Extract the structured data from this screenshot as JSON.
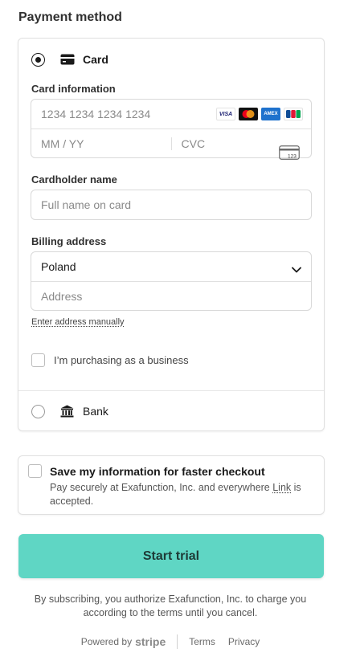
{
  "title": "Payment method",
  "card_option": {
    "label": "Card",
    "selected": true
  },
  "card_info": {
    "label": "Card information",
    "number_placeholder": "1234 1234 1234 1234",
    "expiry_placeholder": "MM / YY",
    "cvc_placeholder": "CVC",
    "brands": [
      "visa-icon",
      "mastercard-icon",
      "amex-icon",
      "jcb-icon"
    ]
  },
  "cardholder": {
    "label": "Cardholder name",
    "placeholder": "Full name on card"
  },
  "billing": {
    "label": "Billing address",
    "country": "Poland",
    "address_placeholder": "Address",
    "manual_link": "Enter address manually"
  },
  "business_checkbox": {
    "label": "I’m purchasing as a business",
    "checked": false
  },
  "bank_option": {
    "label": "Bank",
    "selected": false
  },
  "save_info": {
    "title": "Save my information for faster checkout",
    "desc_prefix": "Pay securely at Exafunction, Inc. and everywhere ",
    "desc_link": "Link",
    "desc_suffix": " is accepted.",
    "checked": false
  },
  "cta_label": "Start trial",
  "legal": "By subscribing, you authorize Exafunction, Inc. to charge you according to the terms until you cancel.",
  "footer": {
    "powered_by": "Powered by",
    "brand": "stripe",
    "terms": "Terms",
    "privacy": "Privacy"
  },
  "colors": {
    "cta": "#5fd6c4",
    "cta_text": "#1e3a36"
  }
}
